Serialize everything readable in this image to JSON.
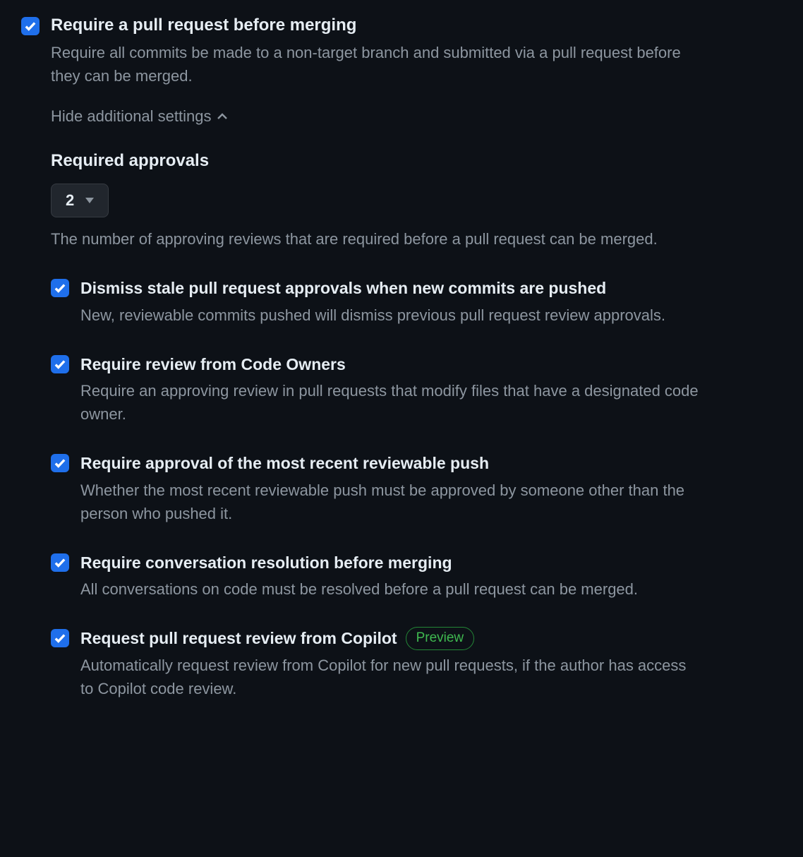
{
  "main": {
    "title": "Require a pull request before merging",
    "description": "Require all commits be made to a non-target branch and submitted via a pull request before they can be merged.",
    "checked": true
  },
  "toggle": {
    "label": "Hide additional settings"
  },
  "approvals": {
    "heading": "Required approvals",
    "value": "2",
    "description": "The number of approving reviews that are required before a pull request can be merged."
  },
  "subsettings": [
    {
      "title": "Dismiss stale pull request approvals when new commits are pushed",
      "description": "New, reviewable commits pushed will dismiss previous pull request review approvals.",
      "checked": true,
      "badge": null
    },
    {
      "title": "Require review from Code Owners",
      "description": "Require an approving review in pull requests that modify files that have a designated code owner.",
      "checked": true,
      "badge": null
    },
    {
      "title": "Require approval of the most recent reviewable push",
      "description": "Whether the most recent reviewable push must be approved by someone other than the person who pushed it.",
      "checked": true,
      "badge": null
    },
    {
      "title": "Require conversation resolution before merging",
      "description": "All conversations on code must be resolved before a pull request can be merged.",
      "checked": true,
      "badge": null
    },
    {
      "title": "Request pull request review from Copilot",
      "description": "Automatically request review from Copilot for new pull requests, if the author has access to Copilot code review.",
      "checked": true,
      "badge": "Preview"
    }
  ]
}
